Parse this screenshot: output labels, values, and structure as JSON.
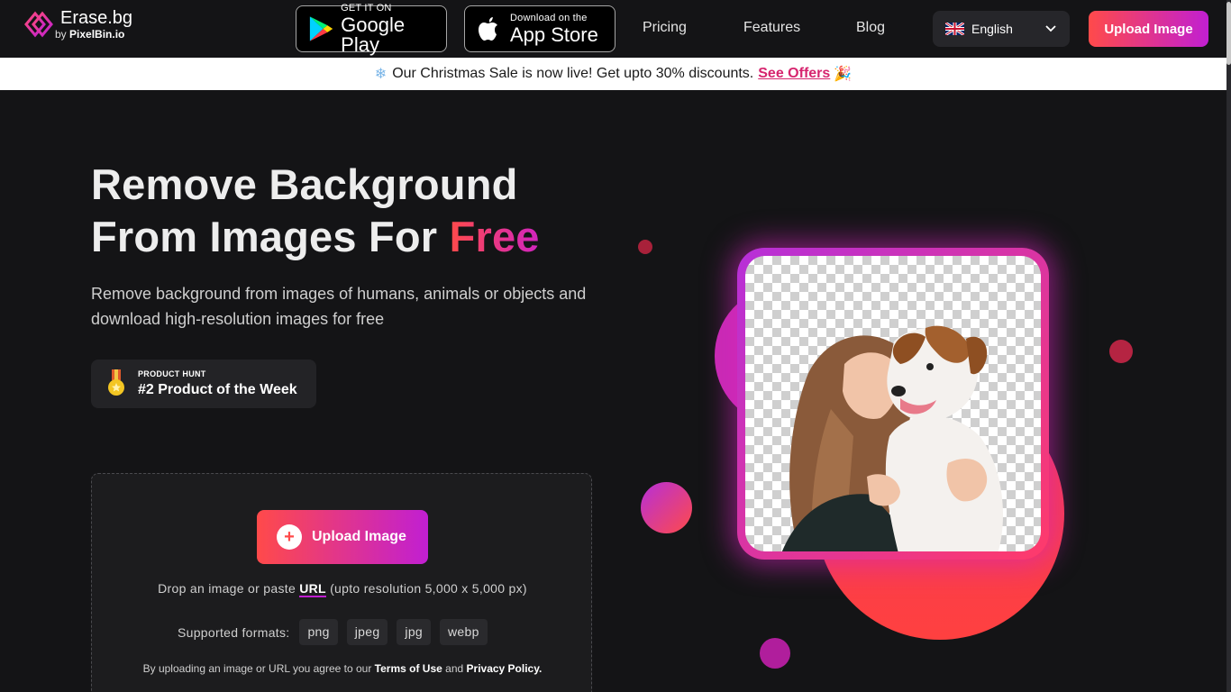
{
  "header": {
    "logo_title": "Erase.bg",
    "logo_by": "by",
    "logo_brand": "PixelBin.io",
    "google_play_small": "GET IT ON",
    "google_play_big": "Google Play",
    "app_store_small": "Download on the",
    "app_store_big": "App Store",
    "nav": [
      "Pricing",
      "Features",
      "Blog"
    ],
    "language": "English",
    "upload_label": "Upload Image"
  },
  "banner": {
    "icon": "snowflake-icon",
    "text": "Our Christmas Sale is now live! Get upto 30% discounts.",
    "offer_link": "See Offers",
    "trailing_icon": "party-popper-icon"
  },
  "hero": {
    "title_line1": "Remove Background",
    "title_line2": "From Images For ",
    "title_highlight": "Free",
    "subtitle": "Remove background from images of humans, animals or objects and download high-resolution images for free",
    "badge_small": "PRODUCT HUNT",
    "badge_big": "#2 Product of the Week"
  },
  "upload": {
    "button_label": "Upload Image",
    "drop_prefix": "Drop an image or paste ",
    "drop_link": "URL",
    "drop_suffix": " (upto resolution 5,000 x 5,000 px)",
    "formats_label": "Supported formats:",
    "formats": [
      "png",
      "jpeg",
      "jpg",
      "webp"
    ],
    "terms_prefix": "By uploading an image or URL you agree to our ",
    "terms_link": "Terms of Use",
    "terms_and": " and ",
    "privacy_link": "Privacy Policy."
  },
  "colors": {
    "accent_start": "#ff4a4a",
    "accent_end": "#c11fd2",
    "background": "#141416",
    "offer_link": "#d6246e"
  }
}
